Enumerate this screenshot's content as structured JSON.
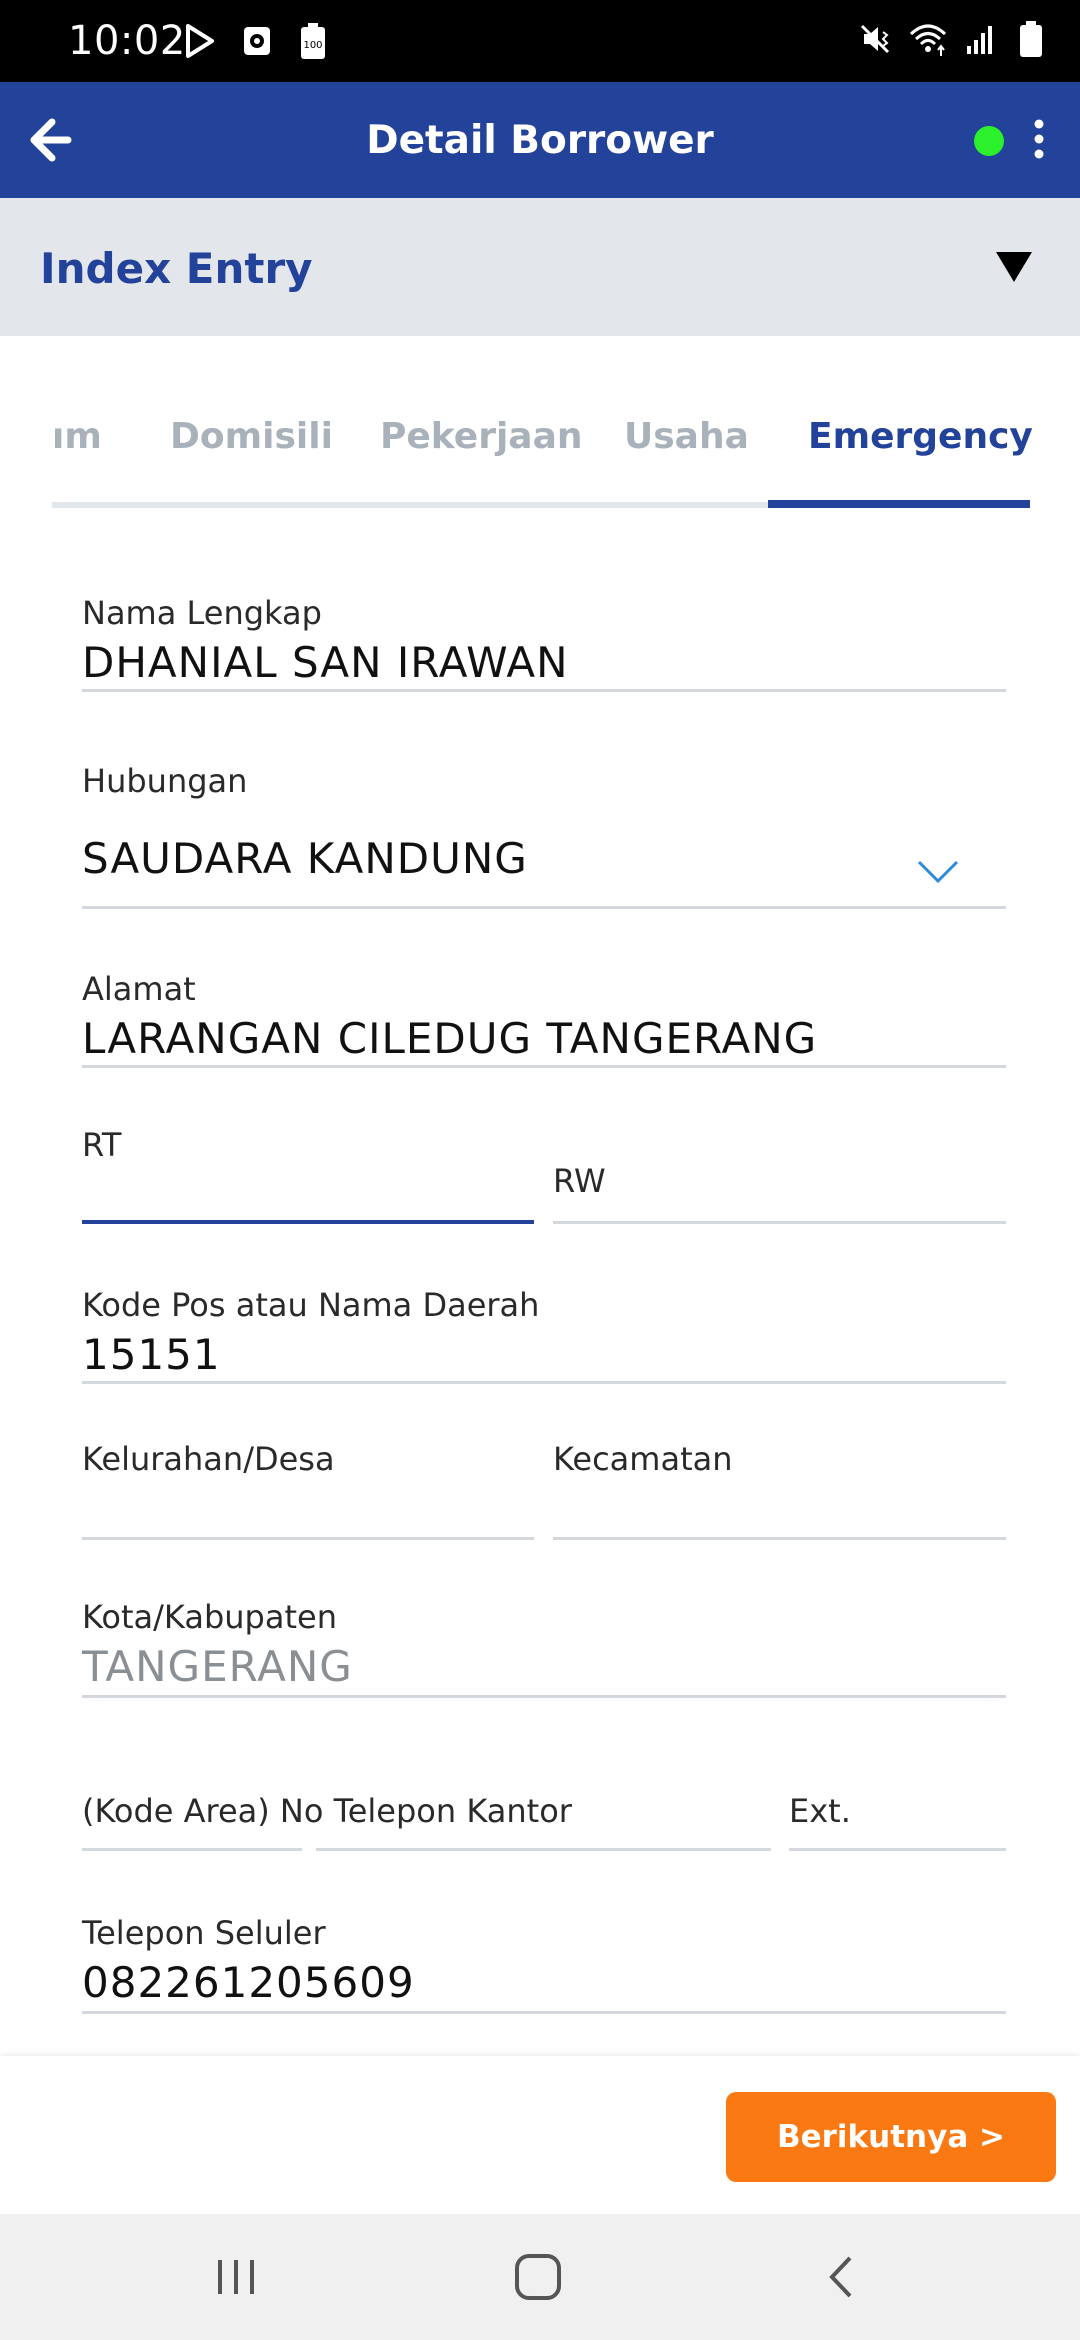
{
  "status_bar": {
    "time": "10:02",
    "icons_left": [
      "play-store-icon",
      "screen-record-icon",
      "battery-100-icon"
    ],
    "icons_right": [
      "mute-vibrate-icon",
      "wifi-icon",
      "signal-icon",
      "battery-icon"
    ]
  },
  "app_bar": {
    "title": "Detail Borrower",
    "status_color": "#2bf02b"
  },
  "index_entry": {
    "label": "Index Entry"
  },
  "tabs": [
    {
      "label": "ım",
      "active": false
    },
    {
      "label": "Domisili",
      "active": false
    },
    {
      "label": "Pekerjaan",
      "active": false
    },
    {
      "label": "Usaha",
      "active": false
    },
    {
      "label": "Emergency",
      "active": true
    }
  ],
  "form": {
    "nama_lengkap": {
      "label": "Nama Lengkap",
      "value": "DHANIAL SAN IRAWAN"
    },
    "hubungan": {
      "label": "Hubungan",
      "value": "SAUDARA KANDUNG"
    },
    "alamat": {
      "label": "Alamat",
      "value": "LARANGAN CILEDUG TANGERANG"
    },
    "rt": {
      "label": "RT",
      "value": ""
    },
    "rw": {
      "label": "RW",
      "value": ""
    },
    "kode_pos": {
      "label": "Kode Pos atau Nama Daerah",
      "value": "15151"
    },
    "kelurahan": {
      "label": "Kelurahan/Desa",
      "value": ""
    },
    "kecamatan": {
      "label": "Kecamatan",
      "value": ""
    },
    "kota": {
      "label": "Kota/Kabupaten",
      "value": "TANGERANG"
    },
    "telepon_kantor": {
      "label": "(Kode Area) No Telepon Kantor",
      "value": ""
    },
    "ext": {
      "label": "Ext.",
      "value": ""
    },
    "telepon_seluler": {
      "label": "Telepon Seluler",
      "value": "082261205609"
    }
  },
  "action": {
    "next_label": "Berikutnya >"
  },
  "colors": {
    "primary": "#23429a",
    "accent": "#fb7912",
    "tab_inactive": "#a9b2ba",
    "section_bg": "#e3e7ec",
    "dropdown_chevron": "#2f8ad8"
  }
}
